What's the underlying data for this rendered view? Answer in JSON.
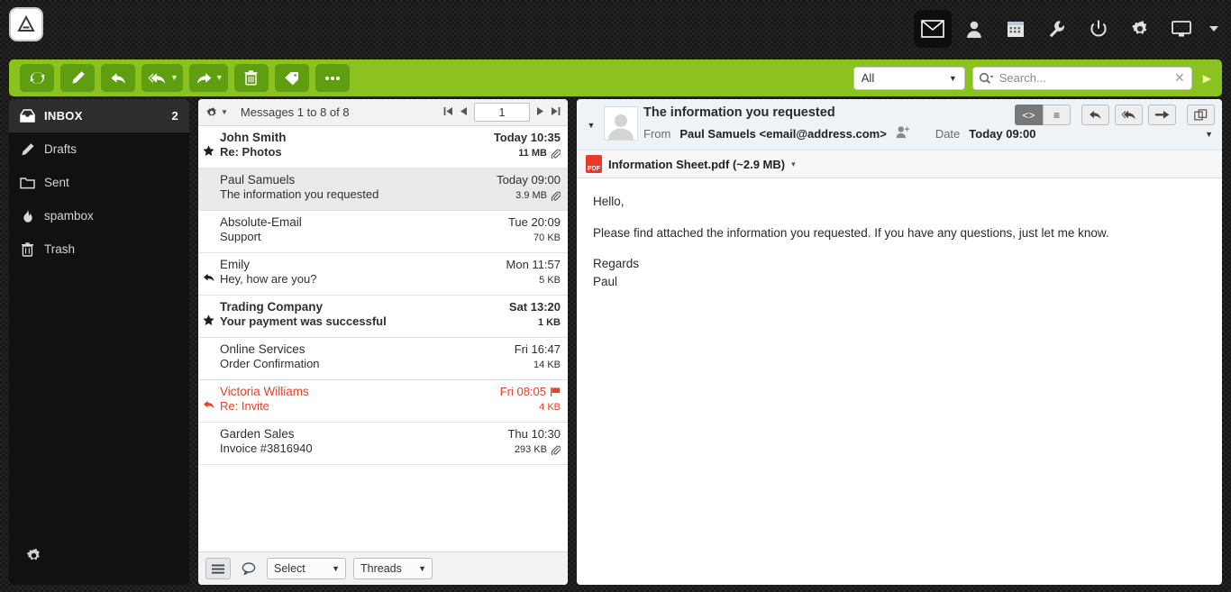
{
  "app": {
    "logo_name": "delta-logo",
    "top_icons": [
      {
        "name": "mail-icon",
        "label": "Mail",
        "active": true
      },
      {
        "name": "contacts-icon",
        "label": "Contacts",
        "active": false
      },
      {
        "name": "calendar-icon",
        "label": "Calendar",
        "active": false
      },
      {
        "name": "wrench-icon",
        "label": "Tools",
        "active": false
      },
      {
        "name": "power-icon",
        "label": "Logout",
        "active": false
      },
      {
        "name": "gear-icon",
        "label": "Settings",
        "active": false
      },
      {
        "name": "monitor-icon",
        "label": "Display",
        "active": false
      },
      {
        "name": "chevron-down-icon",
        "label": "More",
        "active": false
      }
    ]
  },
  "toolbar": {
    "buttons": [
      {
        "name": "refresh-button",
        "icon": "refresh-icon",
        "label": "Refresh",
        "split": false
      },
      {
        "name": "compose-button",
        "icon": "pencil-icon",
        "label": "Compose",
        "split": false
      },
      {
        "name": "reply-button",
        "icon": "reply-icon",
        "label": "Reply",
        "split": false
      },
      {
        "name": "reply-all-button",
        "icon": "reply-all-icon",
        "label": "Reply all",
        "split": true
      },
      {
        "name": "forward-button",
        "icon": "forward-icon",
        "label": "Forward",
        "split": true
      },
      {
        "name": "delete-button",
        "icon": "trash-icon",
        "label": "Delete",
        "split": false
      },
      {
        "name": "tag-button",
        "icon": "tag-icon",
        "label": "Tag",
        "split": false
      },
      {
        "name": "more-button",
        "icon": "ellipsis-icon",
        "label": "More",
        "split": false
      }
    ],
    "scope_select": "All",
    "search_placeholder": "Search...",
    "search_value": "",
    "search_clear": "✕",
    "submit_label": "▶"
  },
  "sidebar": {
    "folders": [
      {
        "name": "sidebar-item-inbox",
        "icon": "inbox-icon",
        "label": "INBOX",
        "count": "2",
        "active": true
      },
      {
        "name": "sidebar-item-drafts",
        "icon": "pencil-icon",
        "label": "Drafts",
        "count": "",
        "active": false
      },
      {
        "name": "sidebar-item-sent",
        "icon": "folder-icon",
        "label": "Sent",
        "count": "",
        "active": false
      },
      {
        "name": "sidebar-item-spambox",
        "icon": "flame-icon",
        "label": "spambox",
        "count": "",
        "active": false
      },
      {
        "name": "sidebar-item-trash",
        "icon": "trash-icon",
        "label": "Trash",
        "count": "",
        "active": false
      }
    ],
    "settings_icon": "gear-icon"
  },
  "list": {
    "header": {
      "options_icon": "gear-icon",
      "title": "Messages 1 to 8 of 8",
      "first_label": "⏮",
      "prev_label": "◀",
      "page_value": "1",
      "next_label": "▶",
      "last_label": "⏭"
    },
    "messages": [
      {
        "from": "John Smith",
        "date": "Today 10:35",
        "subject": "Re: Photos",
        "size": "11 MB",
        "unread": true,
        "selected": false,
        "flagged": false,
        "status_icon": "star-icon",
        "attachment": true
      },
      {
        "from": "Paul Samuels",
        "date": "Today 09:00",
        "subject": "The information you requested",
        "size": "3.9 MB",
        "unread": false,
        "selected": true,
        "flagged": false,
        "status_icon": "",
        "attachment": true
      },
      {
        "from": "Absolute-Email",
        "date": "Tue 20:09",
        "subject": "Support",
        "size": "70 KB",
        "unread": false,
        "selected": false,
        "flagged": false,
        "status_icon": "",
        "attachment": false
      },
      {
        "from": "Emily",
        "date": "Mon 11:57",
        "subject": "Hey, how are you?",
        "size": "5 KB",
        "unread": false,
        "selected": false,
        "flagged": false,
        "status_icon": "reply-icon",
        "attachment": false
      },
      {
        "from": "Trading Company",
        "date": "Sat 13:20",
        "subject": "Your payment was successful",
        "size": "1 KB",
        "unread": true,
        "selected": false,
        "flagged": false,
        "status_icon": "star-icon",
        "attachment": false
      },
      {
        "from": "Online Services",
        "date": "Fri 16:47",
        "subject": "Order Confirmation",
        "size": "14 KB",
        "unread": false,
        "selected": false,
        "flagged": false,
        "status_icon": "",
        "attachment": false
      },
      {
        "from": "Victoria Williams",
        "date": "Fri 08:05",
        "subject": "Re: Invite",
        "size": "4 KB",
        "unread": false,
        "selected": false,
        "flagged": true,
        "status_icon": "reply-icon",
        "attachment": false,
        "flag_icon": "flag-icon"
      },
      {
        "from": "Garden Sales",
        "date": "Thu 10:30",
        "subject": "Invoice #3816940",
        "size": "293 KB",
        "unread": false,
        "selected": false,
        "flagged": false,
        "status_icon": "",
        "attachment": true
      }
    ],
    "footer": {
      "list_view_icon": "list-icon",
      "conversation_icon": "speech-bubble-icon",
      "select_label": "Select",
      "threads_label": "Threads"
    }
  },
  "message": {
    "subject": "The information you requested",
    "from_label": "From",
    "from_value": "Paul Samuels <email@address.com>",
    "add_contact_icon": "add-contact-icon",
    "date_label": "Date",
    "date_value": "Today 09:00",
    "avatar_icon": "avatar-placeholder-icon",
    "collapse_icon": "chevron-down-icon",
    "buttons": [
      {
        "name": "view-source-button",
        "label": "<>",
        "active": true
      },
      {
        "name": "view-list-button",
        "label": "≡",
        "active": false
      },
      {
        "name": "reply-button",
        "label": "reply-icon",
        "active": false
      },
      {
        "name": "reply-all-button",
        "label": "reply-all-icon",
        "active": false
      },
      {
        "name": "forward-button",
        "label": "forward-icon",
        "active": false
      },
      {
        "name": "new-window-button",
        "label": "windows-icon",
        "active": false
      }
    ],
    "attachment": {
      "icon": "pdf-icon",
      "icon_text": "PDF",
      "name": "Information Sheet.pdf (~2.9 MB)",
      "caret": "▾"
    },
    "body": {
      "greeting": "Hello,",
      "paragraph": "Please find attached the information you requested. If you have any questions, just let me know.",
      "closing": "Regards",
      "signature": "Paul"
    }
  },
  "colors": {
    "toolbar_green": "#8bc220",
    "button_green": "#5f9e10",
    "flag_red": "#e8402a",
    "sidebar_dark": "#111111",
    "selected_row": "#eaeaea"
  }
}
